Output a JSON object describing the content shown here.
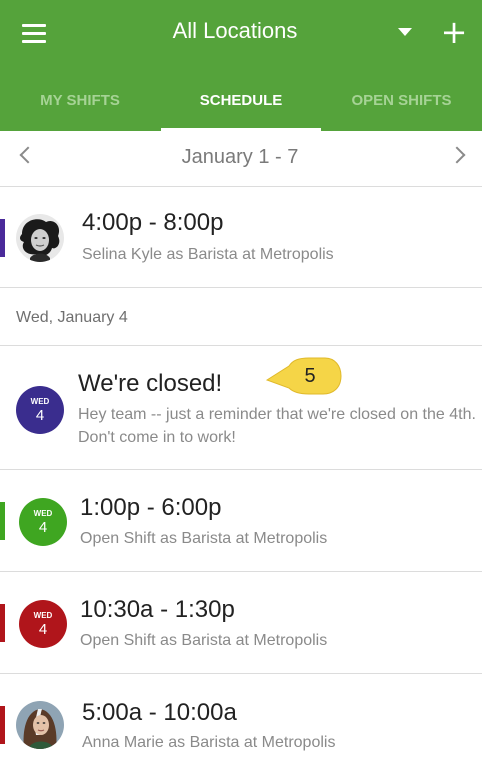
{
  "header": {
    "title": "All Locations",
    "background": "#55a33b",
    "menu_icon": "hamburger-menu-icon",
    "dropdown_icon": "caret-down-icon",
    "add_icon": "plus-icon",
    "add_label": "+"
  },
  "tabs": [
    {
      "label": "MY SHIFTS",
      "active": false
    },
    {
      "label": "SCHEDULE",
      "active": true
    },
    {
      "label": "OPEN SHIFTS",
      "active": false
    }
  ],
  "date_nav": {
    "range": "January 1 - 7",
    "prev_icon": "chevron-left-icon",
    "next_icon": "chevron-right-icon"
  },
  "shifts_top": [
    {
      "time": "4:00p - 8:00p",
      "detail": "Selina Kyle as Barista at Metropolis",
      "color": "#4a2a9a",
      "avatar": "user-avatar"
    }
  ],
  "day_header": "Wed, January 4",
  "annotation": {
    "title": "We're closed!",
    "body": "Hey team -- just a reminder that we're closed on the 4th. Don't come in to work!",
    "badge": {
      "dow": "WED",
      "day": "4",
      "color": "#3a2d8e"
    },
    "callout_number": "5",
    "callout_color": "#f5d547"
  },
  "shifts": [
    {
      "time": "1:00p - 6:00p",
      "detail": "Open Shift as Barista at Metropolis",
      "badge": {
        "dow": "WED",
        "day": "4",
        "color": "#3fa621"
      },
      "stripe": "#3fa621"
    },
    {
      "time": "10:30a - 1:30p",
      "detail": "Open Shift as Barista at Metropolis",
      "badge": {
        "dow": "WED",
        "day": "4",
        "color": "#b0151b"
      },
      "stripe": "#b0151b"
    },
    {
      "time": "5:00a - 10:00a",
      "detail": "Anna Marie as Barista at Metropolis",
      "stripe": "#b0151b",
      "avatar": "user-avatar"
    }
  ]
}
